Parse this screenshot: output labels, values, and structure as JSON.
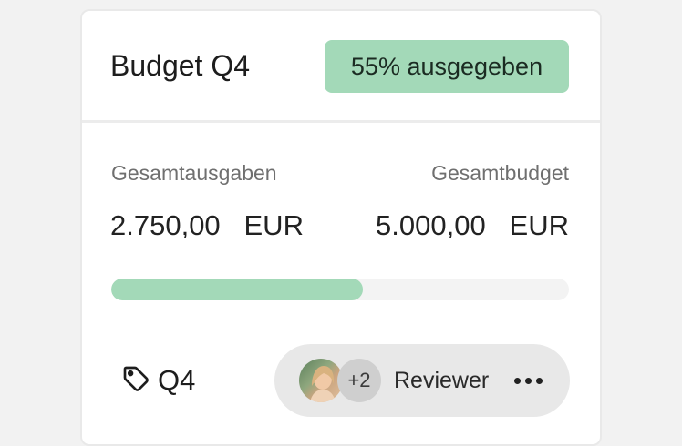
{
  "card": {
    "title": "Budget Q4",
    "badge": "55% ausgegeben",
    "spent_label": "Gesamtausgaben",
    "budget_label": "Gesamtbudget",
    "spent_amount": "2.750,00   EUR",
    "budget_amount": "5.000,00   EUR",
    "progress_percent": 55,
    "tag_label": "Q4",
    "reviewers": {
      "extra_count": "+2",
      "label": "Reviewer"
    }
  },
  "colors": {
    "accent": "#a3d9b8",
    "background": "#f2f2f2",
    "card": "#ffffff",
    "pill": "#e8e8e8"
  },
  "icons": {
    "tag": "tag-icon",
    "more": "more-horizontal-icon"
  }
}
